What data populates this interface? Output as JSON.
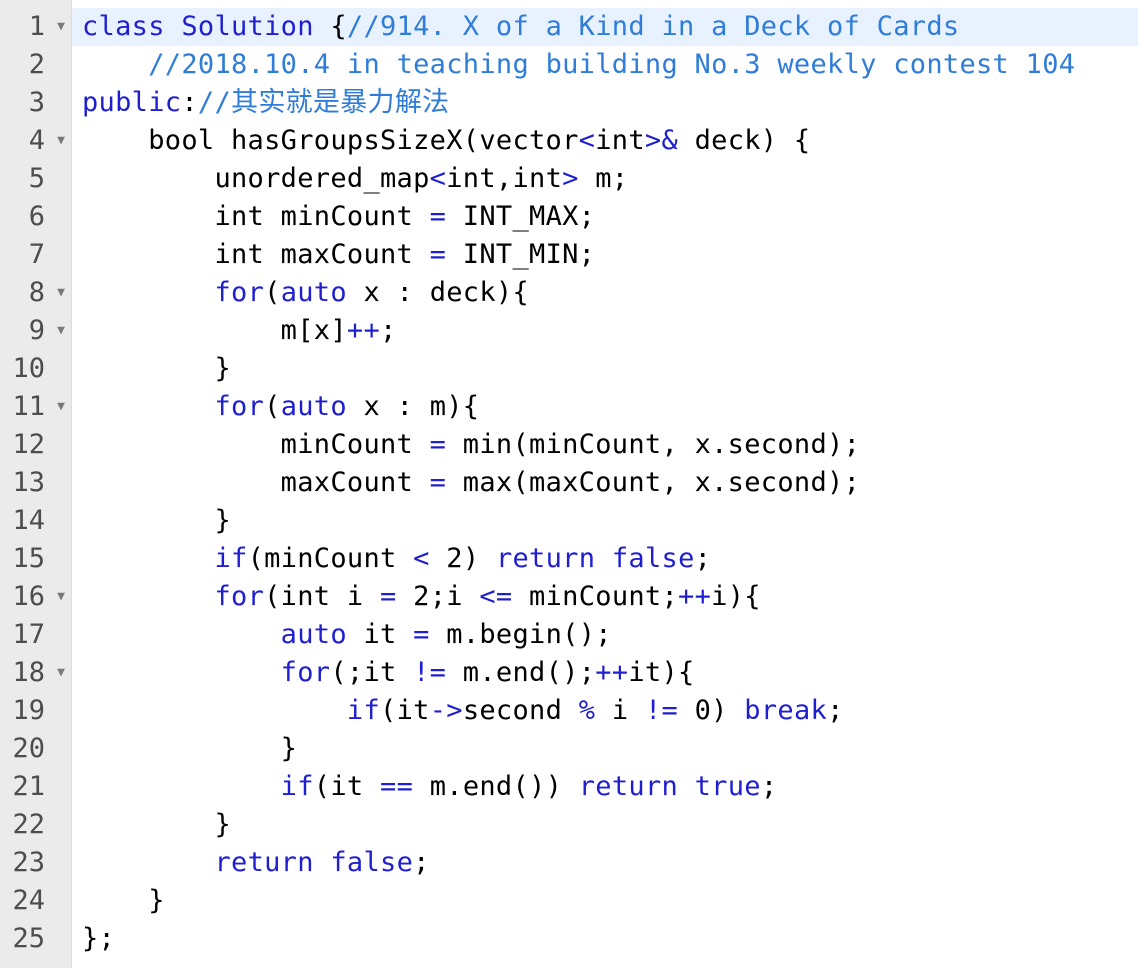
{
  "editor": {
    "active_line": 1,
    "lines": [
      {
        "number": "1",
        "foldable": true,
        "tokens": [
          {
            "t": "class Solution ",
            "k": "keyword"
          },
          {
            "t": "{",
            "k": "text"
          },
          {
            "t": "//914. X of a Kind in a Deck of Cards",
            "k": "comment"
          }
        ]
      },
      {
        "number": "2",
        "foldable": false,
        "tokens": [
          {
            "t": "    ",
            "k": "text"
          },
          {
            "t": "//2018.10.4 in teaching building No.3 weekly contest 104",
            "k": "comment"
          }
        ]
      },
      {
        "number": "3",
        "foldable": false,
        "tokens": [
          {
            "t": "public",
            "k": "keyword"
          },
          {
            "t": ":",
            "k": "text"
          },
          {
            "t": "//其实就是暴力解法",
            "k": "comment"
          }
        ]
      },
      {
        "number": "4",
        "foldable": true,
        "tokens": [
          {
            "t": "    bool hasGroupsSizeX(vector",
            "k": "text"
          },
          {
            "t": "<",
            "k": "op"
          },
          {
            "t": "int",
            "k": "text"
          },
          {
            "t": ">&",
            "k": "op"
          },
          {
            "t": " deck) {",
            "k": "text"
          }
        ]
      },
      {
        "number": "5",
        "foldable": false,
        "tokens": [
          {
            "t": "        unordered_map",
            "k": "text"
          },
          {
            "t": "<",
            "k": "op"
          },
          {
            "t": "int,int",
            "k": "text"
          },
          {
            "t": ">",
            "k": "op"
          },
          {
            "t": " m;",
            "k": "text"
          }
        ]
      },
      {
        "number": "6",
        "foldable": false,
        "tokens": [
          {
            "t": "        int minCount ",
            "k": "text"
          },
          {
            "t": "=",
            "k": "op"
          },
          {
            "t": " INT_MAX;",
            "k": "text"
          }
        ]
      },
      {
        "number": "7",
        "foldable": false,
        "tokens": [
          {
            "t": "        int maxCount ",
            "k": "text"
          },
          {
            "t": "=",
            "k": "op"
          },
          {
            "t": " INT_MIN;",
            "k": "text"
          }
        ]
      },
      {
        "number": "8",
        "foldable": true,
        "tokens": [
          {
            "t": "        ",
            "k": "text"
          },
          {
            "t": "for",
            "k": "keyword"
          },
          {
            "t": "(",
            "k": "text"
          },
          {
            "t": "auto",
            "k": "keyword"
          },
          {
            "t": " x : deck){",
            "k": "text"
          }
        ]
      },
      {
        "number": "9",
        "foldable": true,
        "tokens": [
          {
            "t": "            m[x]",
            "k": "text"
          },
          {
            "t": "++",
            "k": "op"
          },
          {
            "t": ";",
            "k": "text"
          }
        ]
      },
      {
        "number": "10",
        "foldable": false,
        "tokens": [
          {
            "t": "        }",
            "k": "text"
          }
        ]
      },
      {
        "number": "11",
        "foldable": true,
        "tokens": [
          {
            "t": "        ",
            "k": "text"
          },
          {
            "t": "for",
            "k": "keyword"
          },
          {
            "t": "(",
            "k": "text"
          },
          {
            "t": "auto",
            "k": "keyword"
          },
          {
            "t": " x : m){",
            "k": "text"
          }
        ]
      },
      {
        "number": "12",
        "foldable": false,
        "tokens": [
          {
            "t": "            minCount ",
            "k": "text"
          },
          {
            "t": "=",
            "k": "op"
          },
          {
            "t": " min(minCount, x.second);",
            "k": "text"
          }
        ]
      },
      {
        "number": "13",
        "foldable": false,
        "tokens": [
          {
            "t": "            maxCount ",
            "k": "text"
          },
          {
            "t": "=",
            "k": "op"
          },
          {
            "t": " max(maxCount, x.second);",
            "k": "text"
          }
        ]
      },
      {
        "number": "14",
        "foldable": false,
        "tokens": [
          {
            "t": "        }",
            "k": "text"
          }
        ]
      },
      {
        "number": "15",
        "foldable": false,
        "tokens": [
          {
            "t": "        ",
            "k": "text"
          },
          {
            "t": "if",
            "k": "keyword"
          },
          {
            "t": "(minCount ",
            "k": "text"
          },
          {
            "t": "<",
            "k": "op"
          },
          {
            "t": " 2) ",
            "k": "text"
          },
          {
            "t": "return",
            "k": "keyword"
          },
          {
            "t": " ",
            "k": "text"
          },
          {
            "t": "false",
            "k": "keyword"
          },
          {
            "t": ";",
            "k": "text"
          }
        ]
      },
      {
        "number": "16",
        "foldable": true,
        "tokens": [
          {
            "t": "        ",
            "k": "text"
          },
          {
            "t": "for",
            "k": "keyword"
          },
          {
            "t": "(int i ",
            "k": "text"
          },
          {
            "t": "=",
            "k": "op"
          },
          {
            "t": " 2;i ",
            "k": "text"
          },
          {
            "t": "<=",
            "k": "op"
          },
          {
            "t": " minCount;",
            "k": "text"
          },
          {
            "t": "++",
            "k": "op"
          },
          {
            "t": "i){",
            "k": "text"
          }
        ]
      },
      {
        "number": "17",
        "foldable": false,
        "tokens": [
          {
            "t": "            ",
            "k": "text"
          },
          {
            "t": "auto",
            "k": "keyword"
          },
          {
            "t": " it ",
            "k": "text"
          },
          {
            "t": "=",
            "k": "op"
          },
          {
            "t": " m.begin();",
            "k": "text"
          }
        ]
      },
      {
        "number": "18",
        "foldable": true,
        "tokens": [
          {
            "t": "            ",
            "k": "text"
          },
          {
            "t": "for",
            "k": "keyword"
          },
          {
            "t": "(;it ",
            "k": "text"
          },
          {
            "t": "!=",
            "k": "op"
          },
          {
            "t": " m.end();",
            "k": "text"
          },
          {
            "t": "++",
            "k": "op"
          },
          {
            "t": "it){",
            "k": "text"
          }
        ]
      },
      {
        "number": "19",
        "foldable": false,
        "tokens": [
          {
            "t": "                ",
            "k": "text"
          },
          {
            "t": "if",
            "k": "keyword"
          },
          {
            "t": "(it",
            "k": "text"
          },
          {
            "t": "->",
            "k": "op"
          },
          {
            "t": "second ",
            "k": "text"
          },
          {
            "t": "%",
            "k": "op"
          },
          {
            "t": " i ",
            "k": "text"
          },
          {
            "t": "!=",
            "k": "op"
          },
          {
            "t": " 0) ",
            "k": "text"
          },
          {
            "t": "break",
            "k": "keyword"
          },
          {
            "t": ";",
            "k": "text"
          }
        ]
      },
      {
        "number": "20",
        "foldable": false,
        "tokens": [
          {
            "t": "            }",
            "k": "text"
          }
        ]
      },
      {
        "number": "21",
        "foldable": false,
        "tokens": [
          {
            "t": "            ",
            "k": "text"
          },
          {
            "t": "if",
            "k": "keyword"
          },
          {
            "t": "(it ",
            "k": "text"
          },
          {
            "t": "==",
            "k": "op"
          },
          {
            "t": " m.end()) ",
            "k": "text"
          },
          {
            "t": "return",
            "k": "keyword"
          },
          {
            "t": " ",
            "k": "text"
          },
          {
            "t": "true",
            "k": "keyword"
          },
          {
            "t": ";",
            "k": "text"
          }
        ]
      },
      {
        "number": "22",
        "foldable": false,
        "tokens": [
          {
            "t": "        }",
            "k": "text"
          }
        ]
      },
      {
        "number": "23",
        "foldable": false,
        "tokens": [
          {
            "t": "        ",
            "k": "text"
          },
          {
            "t": "return",
            "k": "keyword"
          },
          {
            "t": " ",
            "k": "text"
          },
          {
            "t": "false",
            "k": "keyword"
          },
          {
            "t": ";",
            "k": "text"
          }
        ]
      },
      {
        "number": "24",
        "foldable": false,
        "tokens": [
          {
            "t": "    }",
            "k": "text"
          }
        ]
      },
      {
        "number": "25",
        "foldable": false,
        "tokens": [
          {
            "t": "};",
            "k": "text"
          }
        ]
      }
    ]
  },
  "colors": {
    "keyword": "#1f1fd0",
    "comment": "#2f7dd8",
    "text": "#000000",
    "gutter_bg": "#ebebeb",
    "active_line_bg": "#e8f2ff"
  },
  "icons": {
    "fold": "chevron-down-icon"
  }
}
